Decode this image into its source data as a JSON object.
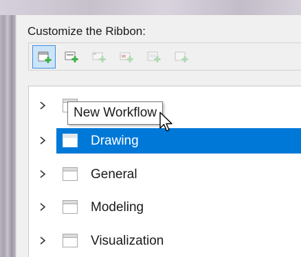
{
  "dialog": {
    "title": "Customize the Ribbon:"
  },
  "toolbar": {
    "buttons": [
      {
        "icon": "new-workflow-icon",
        "state": "active"
      },
      {
        "icon": "new-panel-icon",
        "state": "enabled"
      },
      {
        "icon": "new-subpanel-icon",
        "state": "disabled"
      },
      {
        "icon": "new-item-icon",
        "state": "disabled"
      },
      {
        "icon": "new-group-icon",
        "state": "disabled"
      },
      {
        "icon": "new-command-icon",
        "state": "disabled"
      }
    ]
  },
  "tooltip": {
    "text": "New Workflow"
  },
  "tree": {
    "items": [
      {
        "label": "",
        "selected": false
      },
      {
        "label": "Drawing",
        "selected": true
      },
      {
        "label": "General",
        "selected": false
      },
      {
        "label": "Modeling",
        "selected": false
      },
      {
        "label": "Visualization",
        "selected": false
      }
    ]
  },
  "colors": {
    "selection": "#0078d7",
    "active_button_bg": "#cce4f7",
    "active_button_border": "#3d8ee0",
    "plus_green": "#3cb043"
  }
}
